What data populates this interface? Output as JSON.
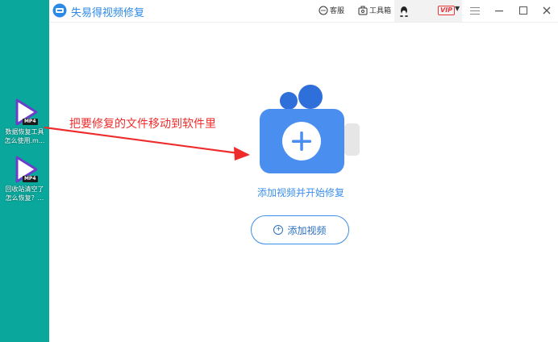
{
  "app": {
    "title": "失易得视频修复"
  },
  "toolbar": {
    "service_label": "客服",
    "toolbox_label": "工具箱",
    "vip_label": "VIP"
  },
  "desktop": {
    "icons": [
      {
        "badge": "MP4",
        "line1": "数据恢复工具",
        "line2": "怎么使用.m..."
      },
      {
        "badge": "MP4",
        "line1": "回收站清空了",
        "line2": "怎么恢复？..."
      }
    ]
  },
  "main": {
    "hint": "添加视频并开始修复",
    "add_button_label": "添加视频"
  },
  "annotation": {
    "text": "把要修复的文件移动到软件里"
  },
  "colors": {
    "desktop_bg": "#0aa89c",
    "brand_blue": "#2b8ae8",
    "camera_body": "#4a8ff0",
    "annotation_red": "#ee2c2c"
  }
}
